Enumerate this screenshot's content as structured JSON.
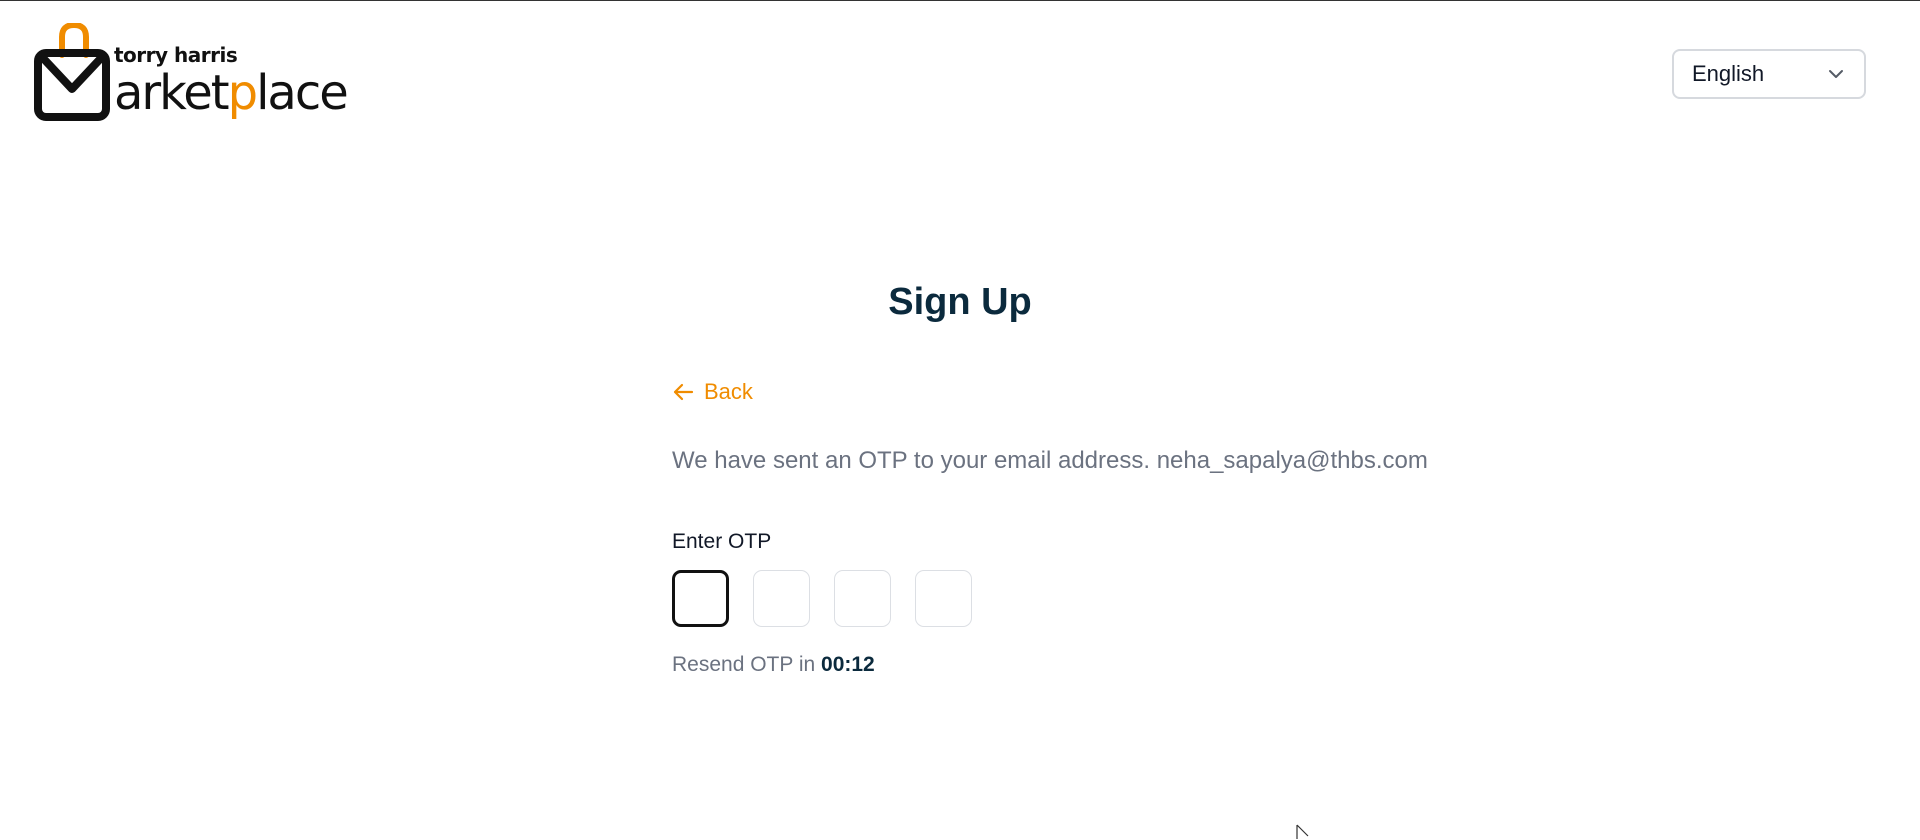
{
  "header": {
    "logo": {
      "small_text": "torry harris",
      "large_text_prefix": "arket",
      "large_text_accent": "p",
      "large_text_suffix": "lace",
      "brand_color": "#f08c00"
    },
    "language_select": {
      "value": "English",
      "icon": "chevron-down-icon"
    }
  },
  "main": {
    "title": "Sign Up",
    "back_label": "Back",
    "back_icon": "arrow-left-icon",
    "otp_message": "We have sent an OTP to your email address. neha_sapalya@thbs.com",
    "otp_label": "Enter OTP",
    "otp_digits": [
      "",
      "",
      "",
      ""
    ],
    "resend_text": "Resend OTP in ",
    "resend_timer": "00:12"
  },
  "colors": {
    "accent": "#f08c00",
    "title": "#0b2a3d",
    "muted_text": "#6b7280"
  }
}
